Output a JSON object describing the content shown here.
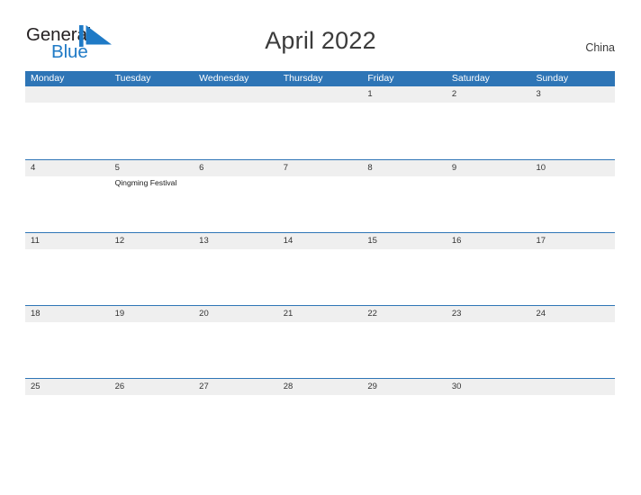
{
  "brand": {
    "name_part1": "General",
    "name_part2": "Blue",
    "mark": "blue-triangle-logo-mark",
    "accent_color": "#1f7ac6"
  },
  "header": {
    "title": "April 2022",
    "region": "China"
  },
  "theme": {
    "header_blue": "#2e75b6",
    "band_gray": "#efefef",
    "text": "#333333",
    "page_background": "#ffffff"
  },
  "calendar": {
    "month": "April",
    "year": "2022",
    "weekday_headers": [
      "Monday",
      "Tuesday",
      "Wednesday",
      "Thursday",
      "Friday",
      "Saturday",
      "Sunday"
    ],
    "weeks": [
      {
        "days": [
          {
            "number": "",
            "events": []
          },
          {
            "number": "",
            "events": []
          },
          {
            "number": "",
            "events": []
          },
          {
            "number": "",
            "events": []
          },
          {
            "number": "1",
            "events": []
          },
          {
            "number": "2",
            "events": []
          },
          {
            "number": "3",
            "events": []
          }
        ]
      },
      {
        "days": [
          {
            "number": "4",
            "events": []
          },
          {
            "number": "5",
            "events": [
              "Qingming Festival"
            ]
          },
          {
            "number": "6",
            "events": []
          },
          {
            "number": "7",
            "events": []
          },
          {
            "number": "8",
            "events": []
          },
          {
            "number": "9",
            "events": []
          },
          {
            "number": "10",
            "events": []
          }
        ]
      },
      {
        "days": [
          {
            "number": "11",
            "events": []
          },
          {
            "number": "12",
            "events": []
          },
          {
            "number": "13",
            "events": []
          },
          {
            "number": "14",
            "events": []
          },
          {
            "number": "15",
            "events": []
          },
          {
            "number": "16",
            "events": []
          },
          {
            "number": "17",
            "events": []
          }
        ]
      },
      {
        "days": [
          {
            "number": "18",
            "events": []
          },
          {
            "number": "19",
            "events": []
          },
          {
            "number": "20",
            "events": []
          },
          {
            "number": "21",
            "events": []
          },
          {
            "number": "22",
            "events": []
          },
          {
            "number": "23",
            "events": []
          },
          {
            "number": "24",
            "events": []
          }
        ]
      },
      {
        "days": [
          {
            "number": "25",
            "events": []
          },
          {
            "number": "26",
            "events": []
          },
          {
            "number": "27",
            "events": []
          },
          {
            "number": "28",
            "events": []
          },
          {
            "number": "29",
            "events": []
          },
          {
            "number": "30",
            "events": []
          },
          {
            "number": "",
            "events": []
          }
        ]
      }
    ]
  }
}
